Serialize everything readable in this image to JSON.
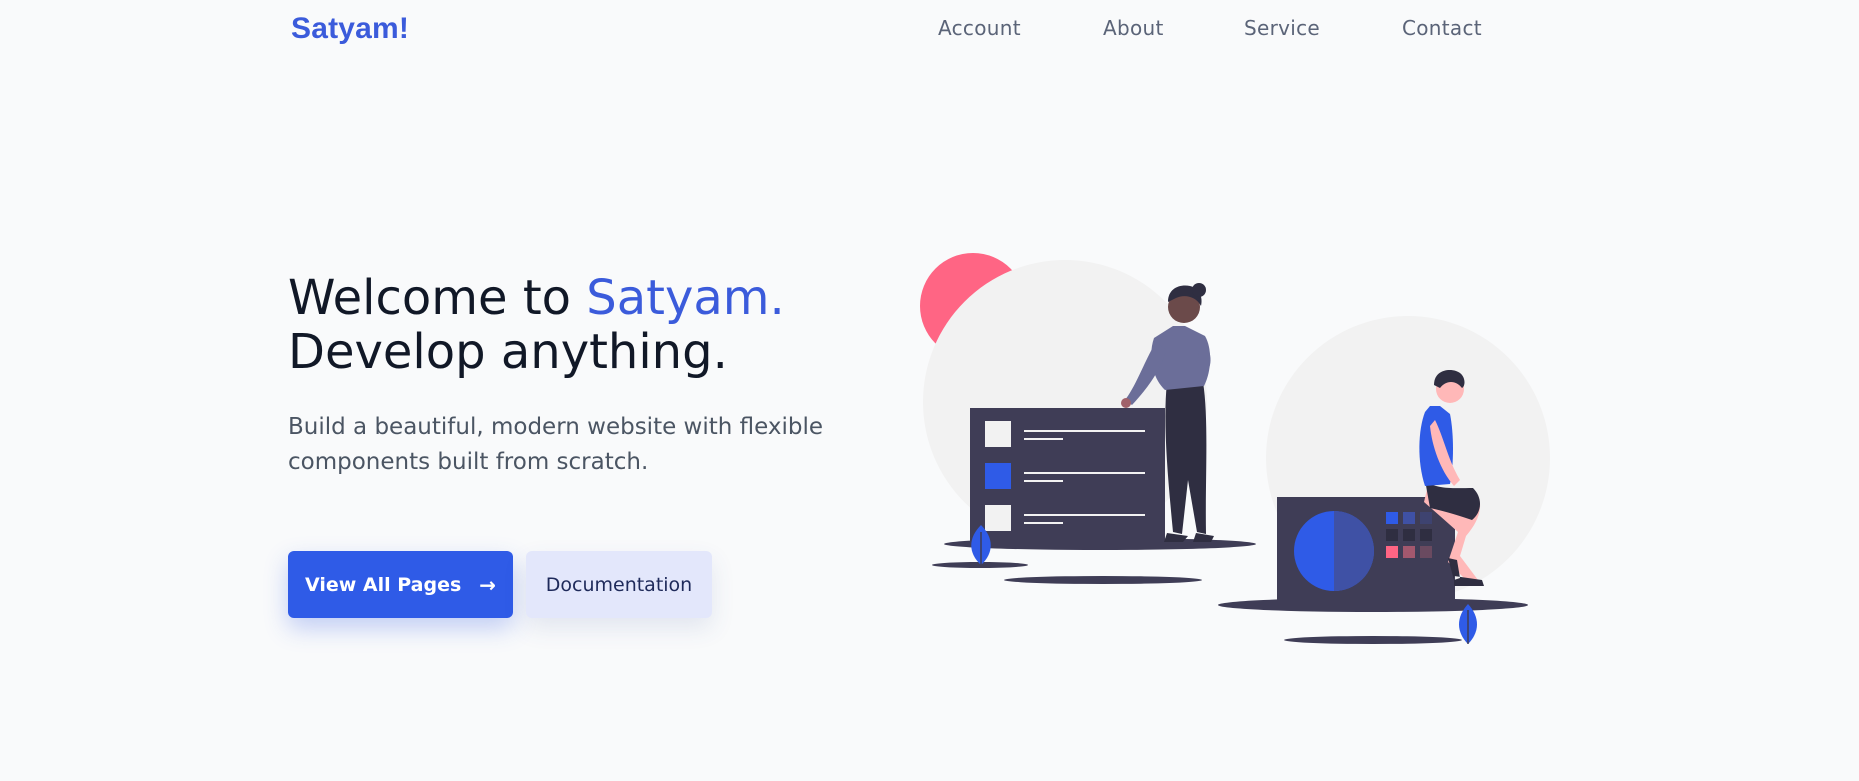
{
  "nav": {
    "brand": "Satyam!",
    "links": [
      "Account",
      "About",
      "Service",
      "Contact"
    ]
  },
  "hero": {
    "title_part1": "Welcome to ",
    "title_accent": "Satyam.",
    "title_line2": "Develop anything.",
    "subtitle": "Build a beautiful, modern website with flexible components built from scratch.",
    "primary_button": "View All Pages",
    "secondary_button": "Documentation"
  },
  "colors": {
    "accent": "#3b5bdb",
    "primary_button": "#2f5be7",
    "secondary_button": "#e3e7fb",
    "background": "#f9fafb",
    "illustration_dark": "#3f3d56",
    "illustration_pink": "#ff6584"
  },
  "icons": {
    "primary_button_icon": "arrow-right-icon"
  }
}
